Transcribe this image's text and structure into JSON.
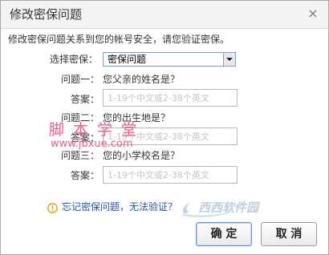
{
  "dialog": {
    "title": "修改密保问题",
    "close_label": "×",
    "description": "修改密保问题关系到您的帐号安全，请您验证密保。"
  },
  "form": {
    "select_label": "选择密保：",
    "select_value": "密保问题",
    "answer_label": "答案：",
    "questions": [
      {
        "label": "问题一：",
        "text": "您父亲的姓名是？",
        "placeholder": "1-19个中文或2-38个英文"
      },
      {
        "label": "问题二：",
        "text": "您的出生地是？",
        "placeholder": "1-19个中文或2-38个英文"
      },
      {
        "label": "问题三：",
        "text": "您的小学校名是？",
        "placeholder": "1-19个中文或2-38个英文"
      }
    ]
  },
  "help": {
    "link_text": "忘记密保问题，无法验证？",
    "icon": "info-icon"
  },
  "buttons": {
    "confirm": "确 定",
    "cancel": "取 消"
  },
  "watermark": {
    "text_cn": "脚本学堂",
    "url": "www.jbxue.com",
    "logo_text": "西西软件园"
  },
  "colors": {
    "link": "#1a55a8",
    "watermark": "#e64a7e",
    "info_icon": "#e39a00"
  }
}
